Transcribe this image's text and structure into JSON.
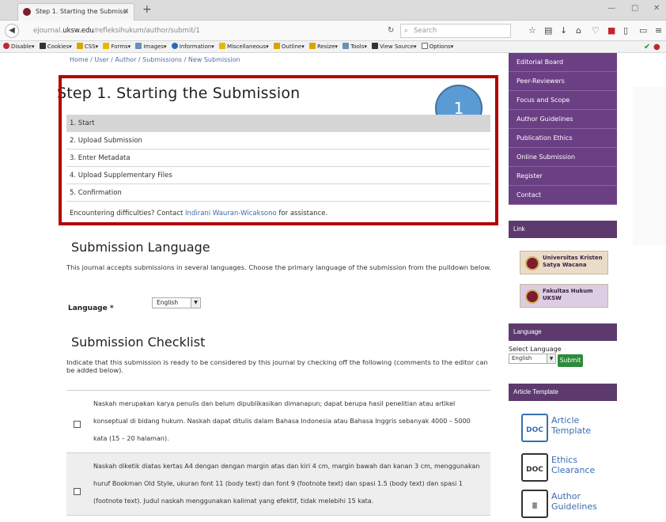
{
  "browser": {
    "tab_title": "Step 1. Starting the Submissi",
    "url_prefix": "ejournal.",
    "url_host": "uksw.edu",
    "url_path": "/refleksihukum/author/submit/1",
    "search_placeholder": "Search"
  },
  "devbar": {
    "items": [
      "Disable▾",
      "Cookies▾",
      "CSS▾",
      "Forms▾",
      "Images▾",
      "Information▾",
      "Miscellaneous▾",
      "Outline▾",
      "Resize▾",
      "Tools▾",
      "View Source▾",
      "Options▾"
    ]
  },
  "main": {
    "breadcrumb": "Home / User / Author / Submissions / New Submission",
    "title": "Step 1. Starting the Submission",
    "badge": "1",
    "steps": [
      "1. Start",
      "2. Upload Submission",
      "3. Enter Metadata",
      "4. Upload Supplementary Files",
      "5. Confirmation"
    ],
    "difficulty_prefix": "Encountering difficulties? Contact ",
    "difficulty_contact": "Indirani Wauran-Wicaksono",
    "difficulty_suffix": " for assistance.",
    "lang_heading": "Submission Language",
    "lang_text": "This journal accepts submissions in several languages. Choose the primary language of the submission from the pulldown below.",
    "lang_label": "Language *",
    "lang_value": "English",
    "checklist_heading": "Submission Checklist",
    "checklist_text": "Indicate that this submission is ready to be considered by this journal by checking off the following (comments to the editor can be added below).",
    "checklist": [
      "Naskah merupakan karya penulis dan belum dipublikasikan dimanapun; dapat berupa hasil penelitian atau artikel konseptual di bidang hukum. Naskah dapat ditulis dalam Bahasa Indonesia atau Bahasa Inggris sebanyak 4000 – 5000 kata (15 – 20 halaman).",
      "Naskah diketik diatas kertas A4 dengan dengan margin atas dan kiri 4 cm, margin bawah dan kanan 3 cm, menggunakan huruf Bookman Old Style, ukuran font 11 (body text) dan font 9 (footnote text) dan spasi 1.5 (body text) dan spasi 1 (footnote text). Judul naskah menggunakan kalimat yang efektif, tidak melebihi 15 kata."
    ]
  },
  "sidebar": {
    "menu": [
      "Editorial Board",
      "Peer-Reviewers",
      "Focus and Scope",
      "Author Guidelines",
      "Publication Ethics",
      "Online Submission",
      "Register",
      "Contact"
    ],
    "link_heading": "Link",
    "banner1": "Universitas Kristen Satya Wacana",
    "banner2": "Fakultas Hukum UKSW",
    "language_heading": "Language",
    "select_language_label": "Select Language",
    "select_language_value": "English",
    "submit_label": "Submit",
    "template_heading": "Article Template",
    "templates": [
      "Article Template",
      "Ethics Clearance",
      "Author Guidelines"
    ]
  },
  "colors": {
    "sidebar_purple": "#6b3f84",
    "highlight_red": "#b30000",
    "badge_blue": "#5b9bd5"
  }
}
